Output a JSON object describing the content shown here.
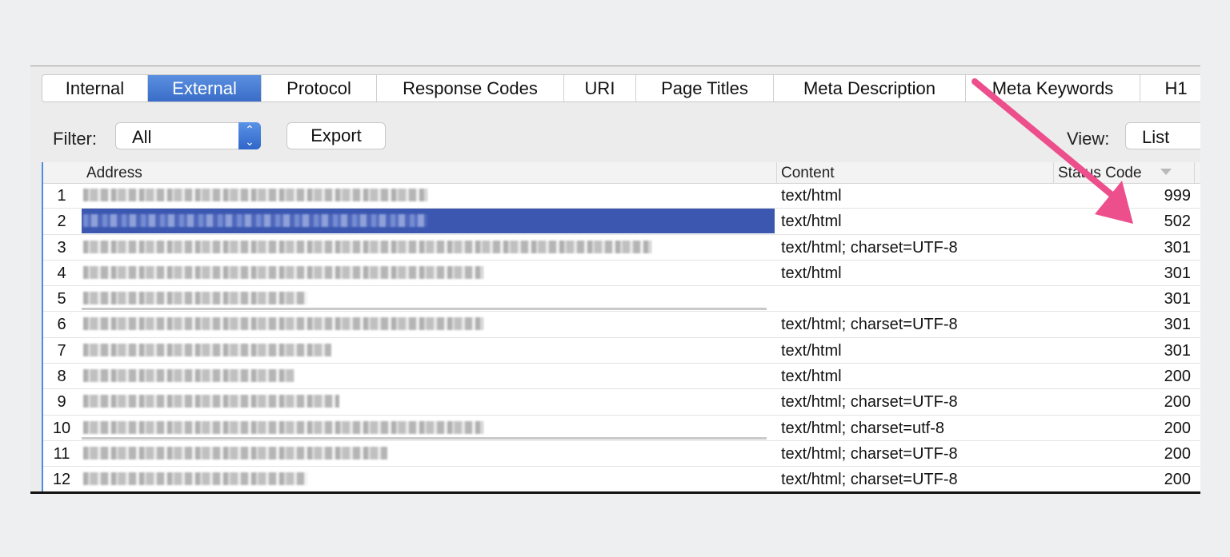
{
  "tabs": [
    {
      "label": "Internal",
      "active": false
    },
    {
      "label": "External",
      "active": true
    },
    {
      "label": "Protocol",
      "active": false
    },
    {
      "label": "Response Codes",
      "active": false
    },
    {
      "label": "URI",
      "active": false
    },
    {
      "label": "Page Titles",
      "active": false
    },
    {
      "label": "Meta Description",
      "active": false
    },
    {
      "label": "Meta Keywords",
      "active": false
    },
    {
      "label": "H1",
      "active": false
    }
  ],
  "toolbar": {
    "filter_label": "Filter:",
    "filter_value": "All",
    "export_label": "Export",
    "view_label": "View:",
    "view_value": "List"
  },
  "table": {
    "columns": [
      "Address",
      "Content",
      "Status Code"
    ],
    "rows": [
      {
        "num": "1",
        "content": "text/html",
        "status": "999",
        "next": ""
      },
      {
        "num": "2",
        "content": "text/html",
        "status": "502",
        "next": ""
      },
      {
        "num": "3",
        "content": "text/html; charset=UTF-8",
        "status": "301",
        "next": ""
      },
      {
        "num": "4",
        "content": "text/html",
        "status": "301",
        "next": ""
      },
      {
        "num": "5",
        "content": "",
        "status": "301",
        "next": ""
      },
      {
        "num": "6",
        "content": "text/html; charset=UTF-8",
        "status": "301",
        "next": ""
      },
      {
        "num": "7",
        "content": "text/html",
        "status": "301",
        "next": ""
      },
      {
        "num": "8",
        "content": "text/html",
        "status": "200",
        "next": "("
      },
      {
        "num": "9",
        "content": "text/html; charset=UTF-8",
        "status": "200",
        "next": "("
      },
      {
        "num": "10",
        "content": "text/html; charset=utf-8",
        "status": "200",
        "next": "("
      },
      {
        "num": "11",
        "content": "text/html; charset=UTF-8",
        "status": "200",
        "next": "("
      },
      {
        "num": "12",
        "content": "text/html; charset=UTF-8",
        "status": "200",
        "next": "("
      }
    ]
  },
  "colors": {
    "accent": "#3a6dc8",
    "selected_row": "#3b57b0",
    "annotation_arrow": "#ec4f8c"
  }
}
